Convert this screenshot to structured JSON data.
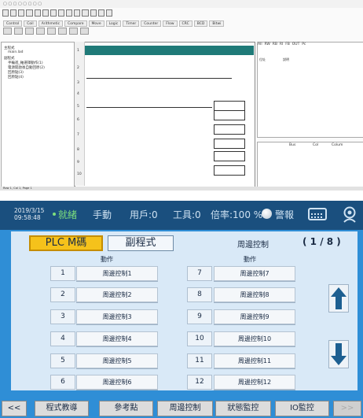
{
  "editor": {
    "tabs": [
      "Control",
      "Coil",
      "Arithmetic",
      "Compare",
      "Move",
      "Logic",
      "Timer",
      "Counter",
      "Flow",
      "CRC",
      "BCD",
      "Bitwi"
    ],
    "tree": [
      "主程式",
      "main.lad",
      "副程式",
      "手輪進_軸選擇動作(1)",
      "電源開啟後自動回原(2)",
      "回原點(3)",
      "回原點(4)"
    ],
    "rows": [
      "1",
      "2",
      "3",
      "4",
      "5",
      "6",
      "7",
      "8",
      "9",
      "10"
    ],
    "right_tabs": [
      "All",
      "RW",
      "RB",
      "RI",
      "FB",
      "OUT",
      "Pc"
    ],
    "right_header": [
      "位址",
      "說明",
      "Bus",
      "Col",
      "Colum"
    ],
    "status": "Row 1, Col 1, Page 1"
  },
  "status_bar": {
    "date": "2019/3/15",
    "time": "09:58:48",
    "mode_status": "就緒",
    "mode": "手動",
    "user": "用戶:0",
    "tool": "工具:0",
    "feed_rate": "倍率:100 %",
    "alarm_label": "警報"
  },
  "panel": {
    "tab_active": "PLC M碼",
    "tab_other": "副程式",
    "section_title": "周邊控制",
    "page": "( 1 / 8 )",
    "column_header": "動作",
    "left_items": [
      {
        "index": "1",
        "label": "周邊控制1"
      },
      {
        "index": "2",
        "label": "周邊控制2"
      },
      {
        "index": "3",
        "label": "周邊控制3"
      },
      {
        "index": "4",
        "label": "周邊控制4"
      },
      {
        "index": "5",
        "label": "周邊控制5"
      },
      {
        "index": "6",
        "label": "周邊控制6"
      }
    ],
    "right_items": [
      {
        "index": "7",
        "label": "周邊控制7"
      },
      {
        "index": "8",
        "label": "周邊控制8"
      },
      {
        "index": "9",
        "label": "周邊控制9"
      },
      {
        "index": "10",
        "label": "周邊控制10"
      },
      {
        "index": "11",
        "label": "周邊控制11"
      },
      {
        "index": "12",
        "label": "周邊控制12"
      }
    ]
  },
  "bottom_nav": {
    "prev": "<<",
    "program_teach": "程式教導",
    "reference_point": "參考點",
    "peripheral_control": "周邊控制",
    "status_monitor": "狀態監控",
    "io_monitor": "IO監控",
    "next": ">>"
  },
  "colors": {
    "hmi_background": "#2f8ed6",
    "status_bar": "#1a4f7e",
    "panel": "#d9e9f7",
    "active_tab": "#f5c21b",
    "teal_header": "#1f7a78"
  }
}
